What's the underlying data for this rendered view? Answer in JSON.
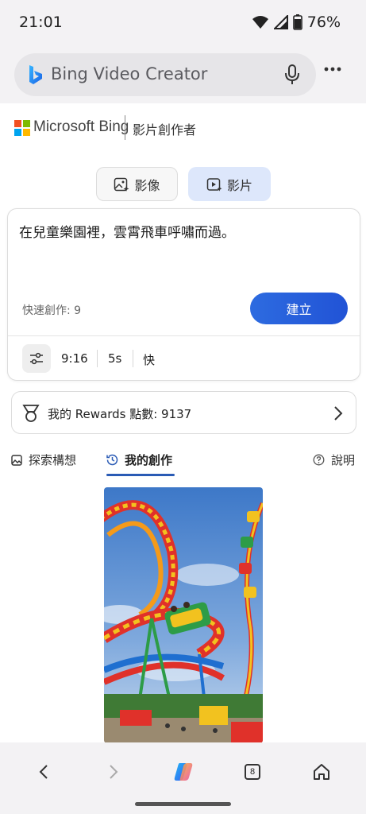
{
  "status": {
    "time": "21:01",
    "battery": "76%"
  },
  "browser": {
    "url_text": "Bing Video Creator"
  },
  "brand": {
    "name": "Microsoft Bing",
    "subtitle": "影片創作者"
  },
  "modes": {
    "image": "影像",
    "video": "影片"
  },
  "prompt": {
    "text": "在兒童樂園裡，雲霄飛車呼嘯而過。",
    "boosts": "快速創作: 9",
    "create": "建立",
    "aspect": "9:16",
    "duration": "5s",
    "speed": "快"
  },
  "rewards": {
    "label": "我的 Rewards 點數: 9137"
  },
  "tabs": {
    "explore": "探索構想",
    "mine": "我的創作",
    "help": "說明"
  },
  "nav": {
    "tab_count": "8"
  },
  "colors": {
    "accent": "#2153d6",
    "active_tab": "#2a5bb5",
    "toggle_active": "#dde7fb"
  }
}
